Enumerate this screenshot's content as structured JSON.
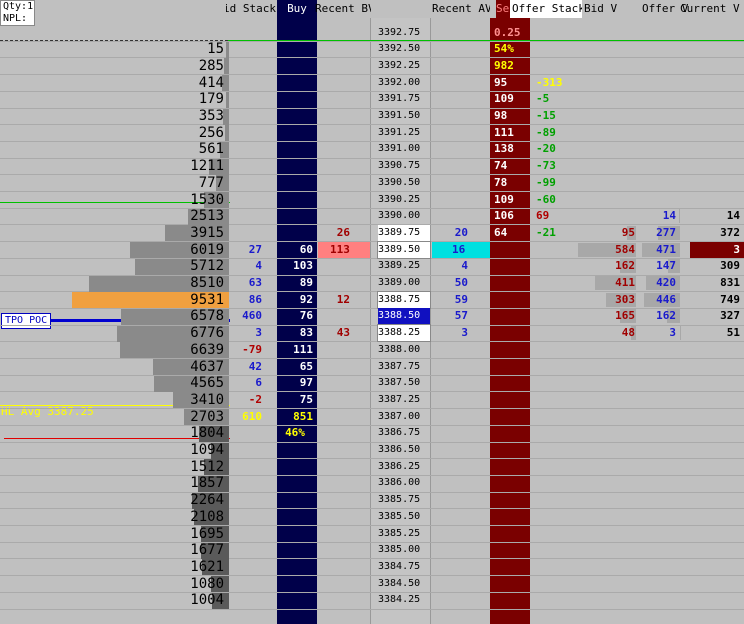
{
  "info_box": {
    "qty": "Qty:1",
    "npl": "NPL:"
  },
  "headers": {
    "bid_stack": "Bid Stack",
    "buy": "Buy",
    "recent_bv": "Recent BV",
    "recent_av": "Recent AV",
    "sell": "Sell",
    "offer_stack": "Offer Stack",
    "bid_v": "Bid V",
    "offer_v": "Offer V",
    "current_v": "Current V"
  },
  "rows": [
    {
      "vol": "",
      "price": "3392.75",
      "sell": "0.25"
    },
    {
      "vol": "15",
      "price": "3392.50",
      "sell": "54%"
    },
    {
      "vol": "285",
      "price": "3392.25",
      "sell": "982"
    },
    {
      "vol": "414",
      "price": "3392.00",
      "sell": "95",
      "os": "-313"
    },
    {
      "vol": "179",
      "price": "3391.75",
      "sell": "109",
      "os": "-5"
    },
    {
      "vol": "353",
      "price": "3391.50",
      "sell": "98",
      "os": "-15"
    },
    {
      "vol": "256",
      "price": "3391.25",
      "sell": "111",
      "os": "-89"
    },
    {
      "vol": "561",
      "price": "3391.00",
      "sell": "138",
      "os": "-20"
    },
    {
      "vol": "1211",
      "price": "3390.75",
      "sell": "74",
      "os": "-73"
    },
    {
      "vol": "777",
      "price": "3390.50",
      "sell": "78",
      "os": "-99"
    },
    {
      "vol": "1530",
      "price": "3390.25",
      "sell": "109",
      "os": "-60"
    },
    {
      "vol": "2513",
      "price": "3390.00",
      "sell": "106",
      "os": "69",
      "ov": "14",
      "cv": "14"
    },
    {
      "vol": "3915",
      "price": "3389.75",
      "rbv": "26",
      "rav": "20",
      "sell": "64",
      "os": "-21",
      "bv": "95",
      "ov": "277",
      "cv": "372"
    },
    {
      "vol": "6019",
      "price": "3389.50",
      "bs": "27",
      "buy": "60",
      "rbv": "113",
      "rav": "16",
      "bv": "584",
      "ov": "471",
      "cv": "3"
    },
    {
      "vol": "5712",
      "price": "3389.25",
      "bs": "4",
      "buy": "103",
      "rav": "4",
      "bv": "162",
      "ov": "147",
      "cv": "309"
    },
    {
      "vol": "8510",
      "price": "3389.00",
      "bs": "63",
      "buy": "89",
      "rav": "50",
      "bv": "411",
      "ov": "420",
      "cv": "831"
    },
    {
      "vol": "9531",
      "price": "3388.75",
      "bs": "86",
      "buy": "92",
      "rbv": "12",
      "rav": "59",
      "bv": "303",
      "ov": "446",
      "cv": "749"
    },
    {
      "vol": "6578",
      "price": "3388.50",
      "bs": "460",
      "buy": "76",
      "rav": "57",
      "bv": "165",
      "ov": "162",
      "cv": "327"
    },
    {
      "vol": "6776",
      "price": "3388.25",
      "bs": "3",
      "buy": "83",
      "rbv": "43",
      "rav": "3",
      "bv": "48",
      "ov": "3",
      "cv": "51"
    },
    {
      "vol": "6639",
      "price": "3388.00",
      "bs": "-79",
      "buy": "111"
    },
    {
      "vol": "4637",
      "price": "3387.75",
      "bs": "42",
      "buy": "65"
    },
    {
      "vol": "4565",
      "price": "3387.50",
      "bs": "6",
      "buy": "97"
    },
    {
      "vol": "3410",
      "price": "3387.25",
      "bs": "-2",
      "buy": "75"
    },
    {
      "vol": "2703",
      "price": "3387.00",
      "bs": "610",
      "buy": "851"
    },
    {
      "vol": "1804",
      "price": "3386.75",
      "buy": "46%"
    },
    {
      "vol": "1094",
      "price": "3386.50"
    },
    {
      "vol": "1512",
      "price": "3386.25"
    },
    {
      "vol": "1857",
      "price": "3386.00"
    },
    {
      "vol": "2264",
      "price": "3385.75"
    },
    {
      "vol": "2108",
      "price": "3385.50"
    },
    {
      "vol": "1695",
      "price": "3385.25"
    },
    {
      "vol": "1677",
      "price": "3385.00"
    },
    {
      "vol": "1621",
      "price": "3384.75"
    },
    {
      "vol": "1080",
      "price": "3384.50"
    },
    {
      "vol": "1004",
      "price": "3384.25"
    }
  ],
  "labels": {
    "tpo_poc": "TPO POC",
    "hl_avg": "HL Avg 3387.25"
  },
  "colors": {
    "background": "#c0c0c0",
    "buy_column": "#00004a",
    "sell_column": "#7a0000",
    "profile_bar": "#8a8a8a",
    "poc_bar": "#f0a040",
    "bid_text": "#1a1acc",
    "neg_text": "#b00000",
    "pos_text": "#00a000",
    "yellow_text": "#ffff00",
    "current_price_bg": "#ffffff",
    "last_price_bg": "#1010c0",
    "recent_bv_hl": "#ff8080",
    "recent_av_hl": "#00e0e0"
  }
}
